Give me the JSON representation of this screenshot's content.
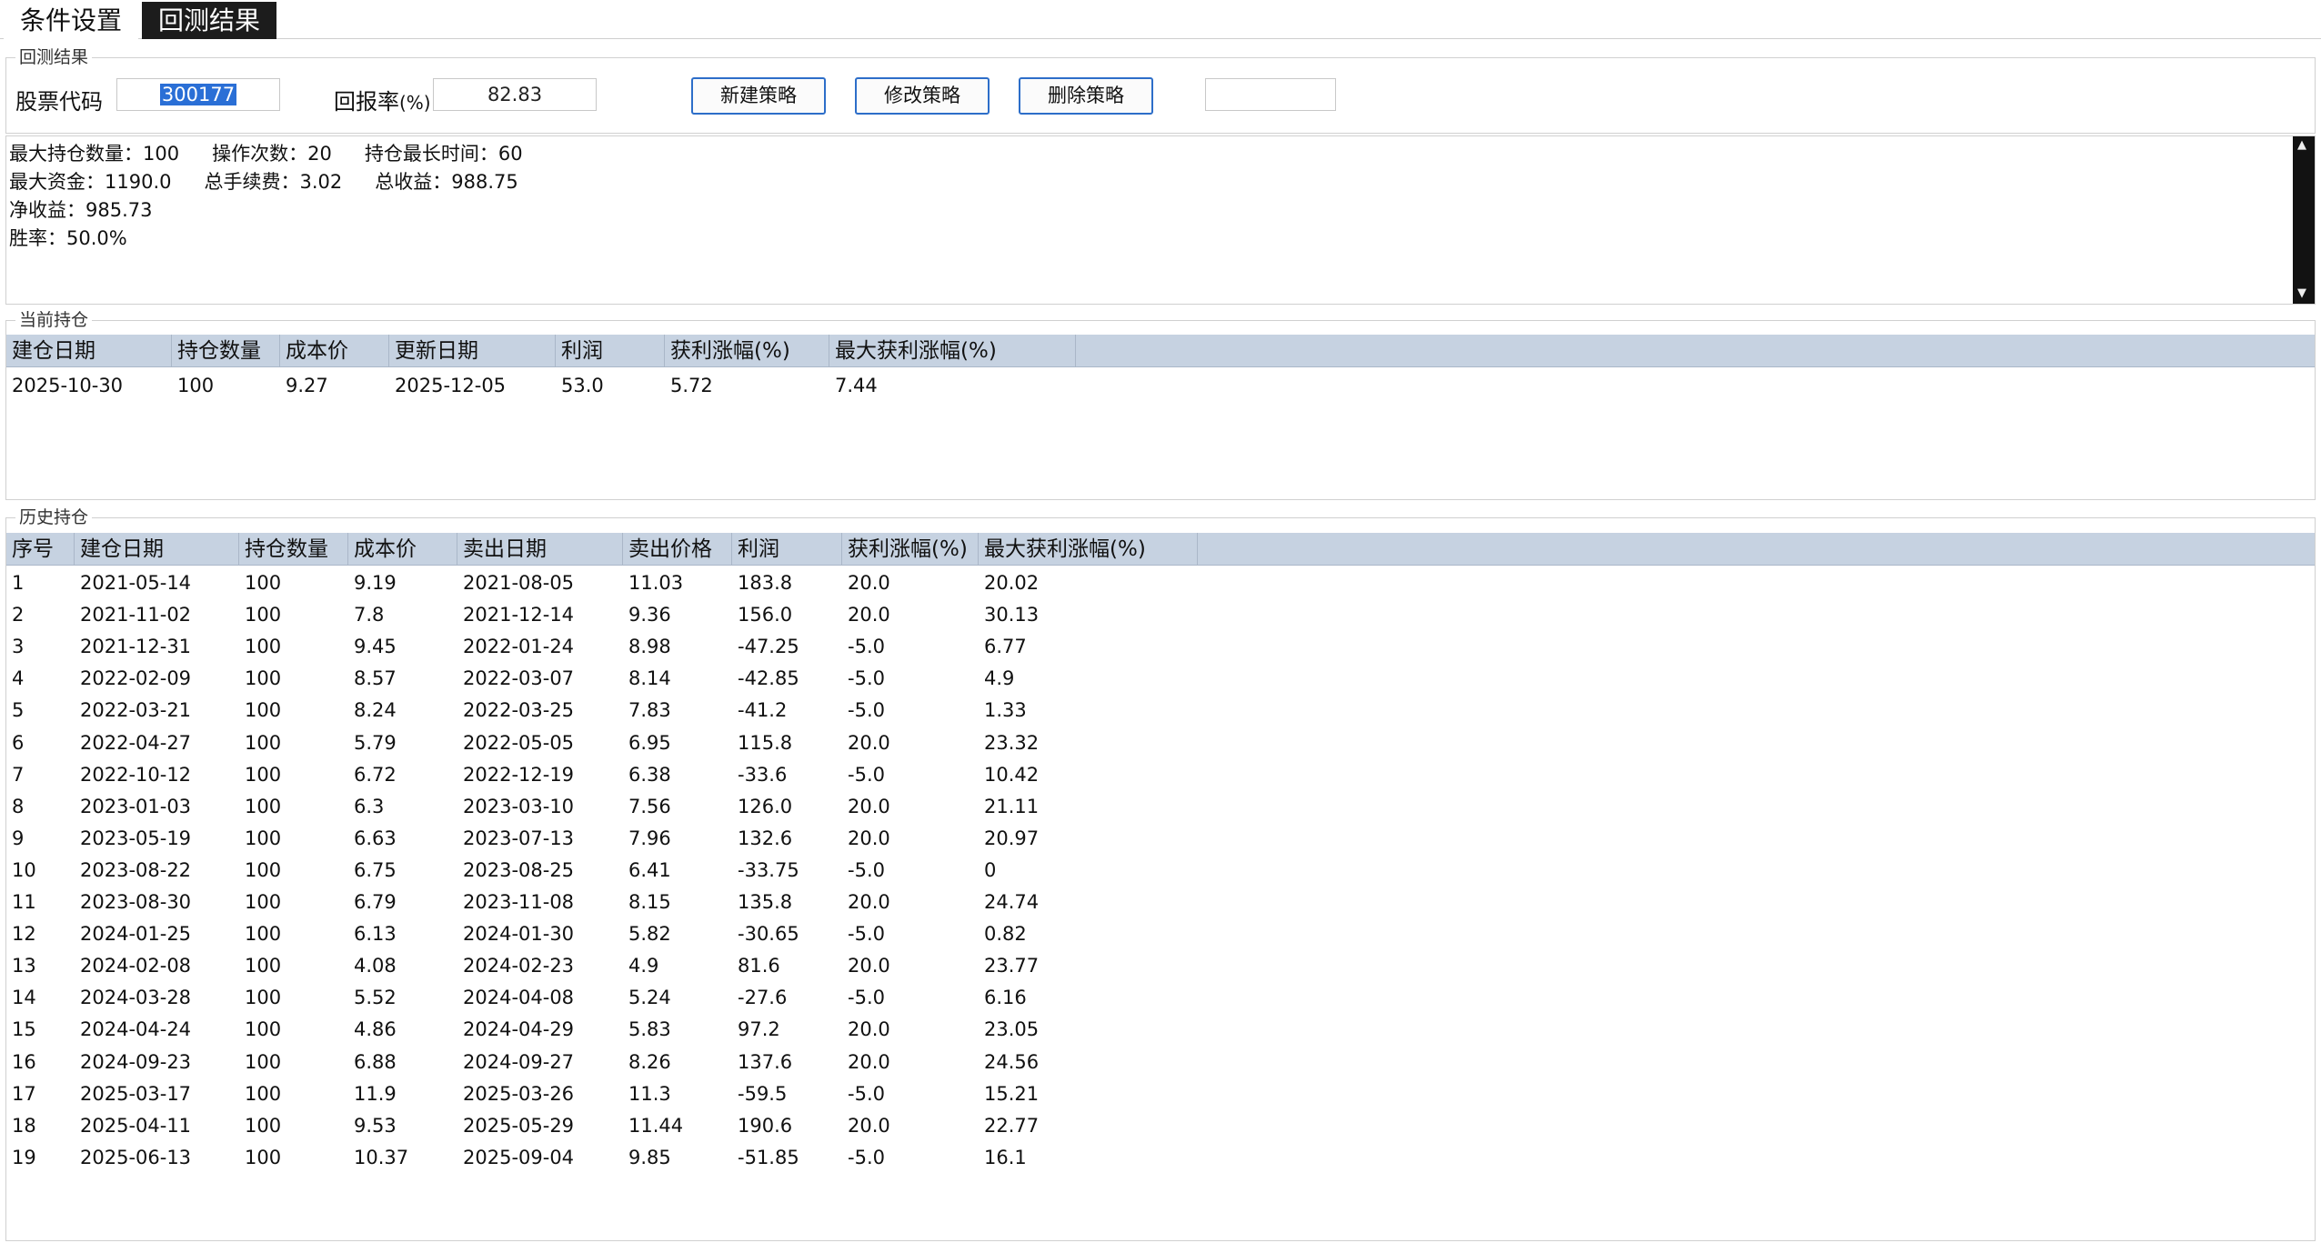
{
  "tabs": [
    {
      "label": "条件设置"
    },
    {
      "label": "回测结果"
    }
  ],
  "backtest": {
    "group_title": "回测结果",
    "stock_code_label": "股票代码",
    "stock_code_value": "300177",
    "return_label": "回报率",
    "return_unit": "(%)",
    "return_value": "82.83",
    "new_strategy": "新建策略",
    "edit_strategy": "修改策略",
    "delete_strategy": "删除策略",
    "extra_value": ""
  },
  "summary": {
    "line1": [
      "最大持仓数量：100",
      "操作次数：20",
      "持仓最长时间：60"
    ],
    "line2": [
      "最大资金：1190.0",
      "总手续费：3.02",
      "总收益：988.75"
    ],
    "line3": [
      "净收益：985.73"
    ],
    "line4": [
      "胜率：50.0%"
    ]
  },
  "current": {
    "group_title": "当前持仓",
    "headers": [
      "建仓日期",
      "持仓数量",
      "成本价",
      "更新日期",
      "利润",
      "获利涨幅(%)",
      "最大获利涨幅(%)"
    ],
    "rows": [
      [
        "2025-10-30",
        "100",
        "9.27",
        "2025-12-05",
        "53.0",
        "5.72",
        "7.44"
      ]
    ]
  },
  "history": {
    "group_title": "历史持仓",
    "headers": [
      "序号",
      "建仓日期",
      "持仓数量",
      "成本价",
      "卖出日期",
      "卖出价格",
      "利润",
      "获利涨幅(%)",
      "最大获利涨幅(%)"
    ],
    "rows": [
      [
        "1",
        "2021-05-14",
        "100",
        "9.19",
        "2021-08-05",
        "11.03",
        "183.8",
        "20.0",
        "20.02"
      ],
      [
        "2",
        "2021-11-02",
        "100",
        "7.8",
        "2021-12-14",
        "9.36",
        "156.0",
        "20.0",
        "30.13"
      ],
      [
        "3",
        "2021-12-31",
        "100",
        "9.45",
        "2022-01-24",
        "8.98",
        "-47.25",
        "-5.0",
        "6.77"
      ],
      [
        "4",
        "2022-02-09",
        "100",
        "8.57",
        "2022-03-07",
        "8.14",
        "-42.85",
        "-5.0",
        "4.9"
      ],
      [
        "5",
        "2022-03-21",
        "100",
        "8.24",
        "2022-03-25",
        "7.83",
        "-41.2",
        "-5.0",
        "1.33"
      ],
      [
        "6",
        "2022-04-27",
        "100",
        "5.79",
        "2022-05-05",
        "6.95",
        "115.8",
        "20.0",
        "23.32"
      ],
      [
        "7",
        "2022-10-12",
        "100",
        "6.72",
        "2022-12-19",
        "6.38",
        "-33.6",
        "-5.0",
        "10.42"
      ],
      [
        "8",
        "2023-01-03",
        "100",
        "6.3",
        "2023-03-10",
        "7.56",
        "126.0",
        "20.0",
        "21.11"
      ],
      [
        "9",
        "2023-05-19",
        "100",
        "6.63",
        "2023-07-13",
        "7.96",
        "132.6",
        "20.0",
        "20.97"
      ],
      [
        "10",
        "2023-08-22",
        "100",
        "6.75",
        "2023-08-25",
        "6.41",
        "-33.75",
        "-5.0",
        "0"
      ],
      [
        "11",
        "2023-08-30",
        "100",
        "6.79",
        "2023-11-08",
        "8.15",
        "135.8",
        "20.0",
        "24.74"
      ],
      [
        "12",
        "2024-01-25",
        "100",
        "6.13",
        "2024-01-30",
        "5.82",
        "-30.65",
        "-5.0",
        "0.82"
      ],
      [
        "13",
        "2024-02-08",
        "100",
        "4.08",
        "2024-02-23",
        "4.9",
        "81.6",
        "20.0",
        "23.77"
      ],
      [
        "14",
        "2024-03-28",
        "100",
        "5.52",
        "2024-04-08",
        "5.24",
        "-27.6",
        "-5.0",
        "6.16"
      ],
      [
        "15",
        "2024-04-24",
        "100",
        "4.86",
        "2024-04-29",
        "5.83",
        "97.2",
        "20.0",
        "23.05"
      ],
      [
        "16",
        "2024-09-23",
        "100",
        "6.88",
        "2024-09-27",
        "8.26",
        "137.6",
        "20.0",
        "24.56"
      ],
      [
        "17",
        "2025-03-17",
        "100",
        "11.9",
        "2025-03-26",
        "11.3",
        "-59.5",
        "-5.0",
        "15.21"
      ],
      [
        "18",
        "2025-04-11",
        "100",
        "9.53",
        "2025-05-29",
        "11.44",
        "190.6",
        "20.0",
        "22.77"
      ],
      [
        "19",
        "2025-06-13",
        "100",
        "10.37",
        "2025-09-04",
        "9.85",
        "-51.85",
        "-5.0",
        "16.1"
      ]
    ]
  }
}
